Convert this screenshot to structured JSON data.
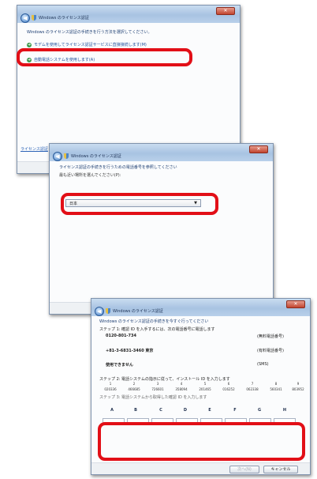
{
  "window1": {
    "title": "Windows のライセンス認証",
    "instruction": "Windows のライセンス認証の手続きを行う方法を選択してください。",
    "option_modem": "モデムを使用してライセンス認証サービスに直接接続します(M)",
    "option_phone": "自動電話システムを使用します(A)",
    "footer_link": "ライセンス認証"
  },
  "window2": {
    "title": "Windows のライセンス認証",
    "instruction": "ライセンス認証の手続きを行うための電話番号を参照してください",
    "location_label": "最も近い場所を選んでください(P):",
    "location_value": "日本"
  },
  "window3": {
    "title": "Windows のライセンス認証",
    "instruction": "Windows のライセンス認証の手続きを今すぐ行ってください",
    "step1": "ステップ 1: 確認 ID を入手するには、次の電話番号に電話します",
    "phones": [
      {
        "number": "0120-801-734",
        "note": "(無料電話番号)"
      },
      {
        "number": "+81-3-6831-3460 東京",
        "note": "(有料電話番号)"
      },
      {
        "number": "使用できません",
        "note": "(SMS)"
      }
    ],
    "step2": "ステップ 2: 電話システムの指示に従って、インストール ID を入力します",
    "group_numbers": [
      "1",
      "2",
      "3",
      "4",
      "5",
      "6",
      "7",
      "8",
      "9"
    ],
    "install_id": [
      "020336",
      "466685",
      "726601",
      "358094",
      "201465",
      "016252",
      "062338",
      "560341",
      "803952"
    ],
    "step3": "ステップ 3: 電話システムから取得した確認 ID を入力します",
    "id_columns": [
      "A",
      "B",
      "C",
      "D",
      "E",
      "F",
      "G",
      "H"
    ],
    "next_button": "次へ(N)",
    "cancel_button": "キャンセル"
  }
}
